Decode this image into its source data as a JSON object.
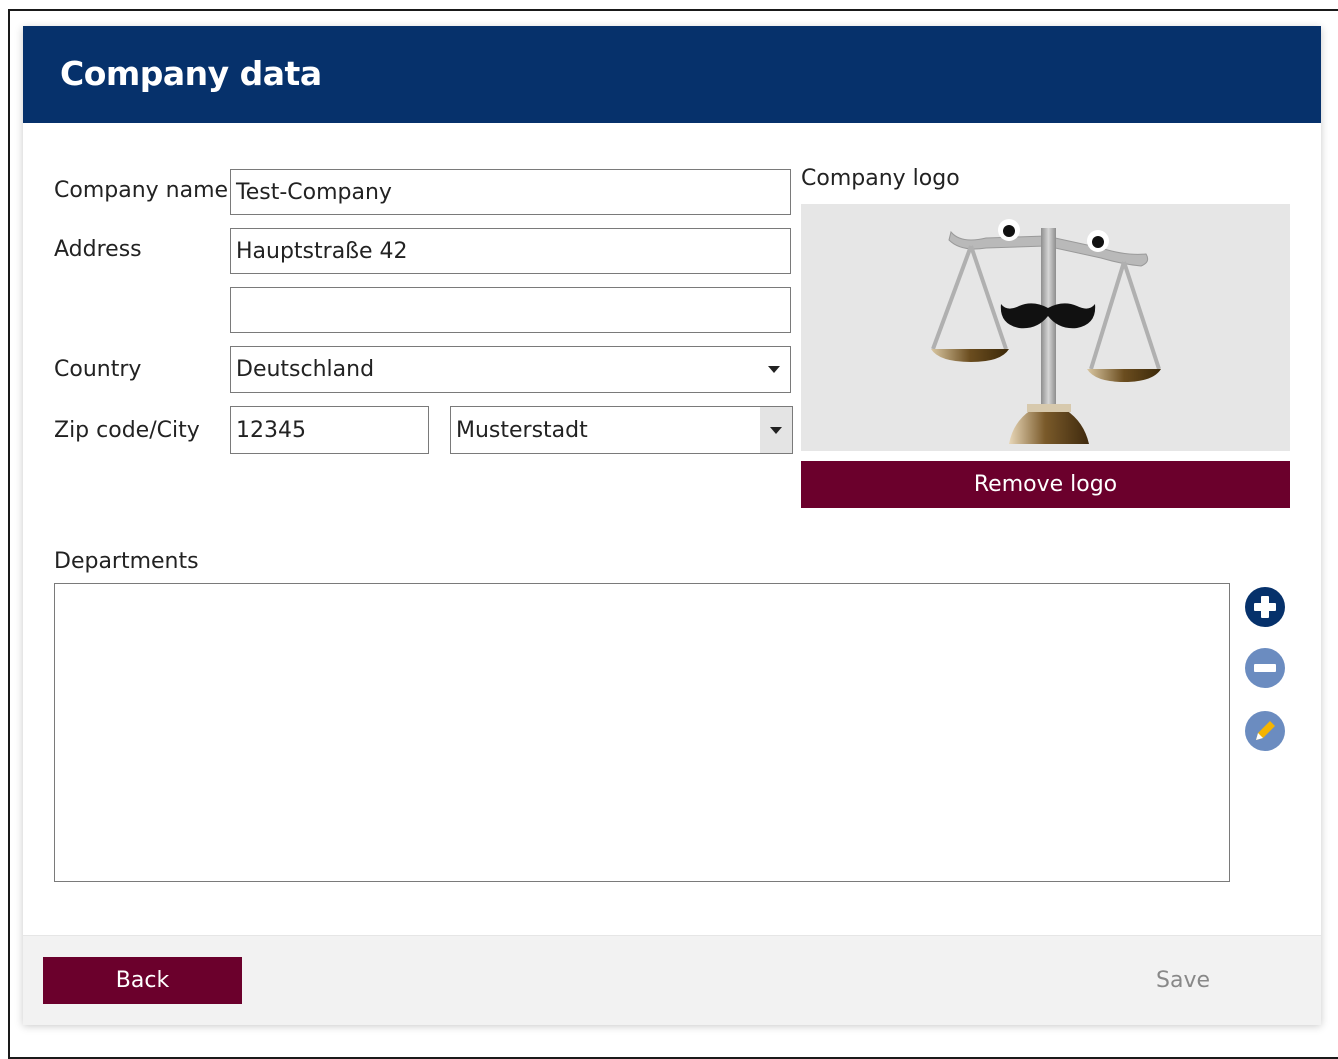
{
  "header": {
    "title": "Company data"
  },
  "form": {
    "company_name_label": "Company name",
    "company_name_value": "Test-Company",
    "address_label": "Address",
    "address_line1_value": "Hauptstraße 42",
    "address_line2_value": "",
    "country_label": "Country",
    "country_value": "Deutschland",
    "zip_city_label": "Zip code/City",
    "zip_value": "12345",
    "city_value": "Musterstadt"
  },
  "logo": {
    "label": "Company logo",
    "remove_button": "Remove logo"
  },
  "departments": {
    "label": "Departments",
    "items": [],
    "icons": [
      "add-icon",
      "remove-icon",
      "edit-icon"
    ]
  },
  "footer": {
    "back_button": "Back",
    "save_button": "Save"
  },
  "colors": {
    "header_bg": "#06316b",
    "accent_maroon": "#6b002c",
    "icon_dark": "#06316b",
    "icon_disabled": "#6b8cc0"
  }
}
